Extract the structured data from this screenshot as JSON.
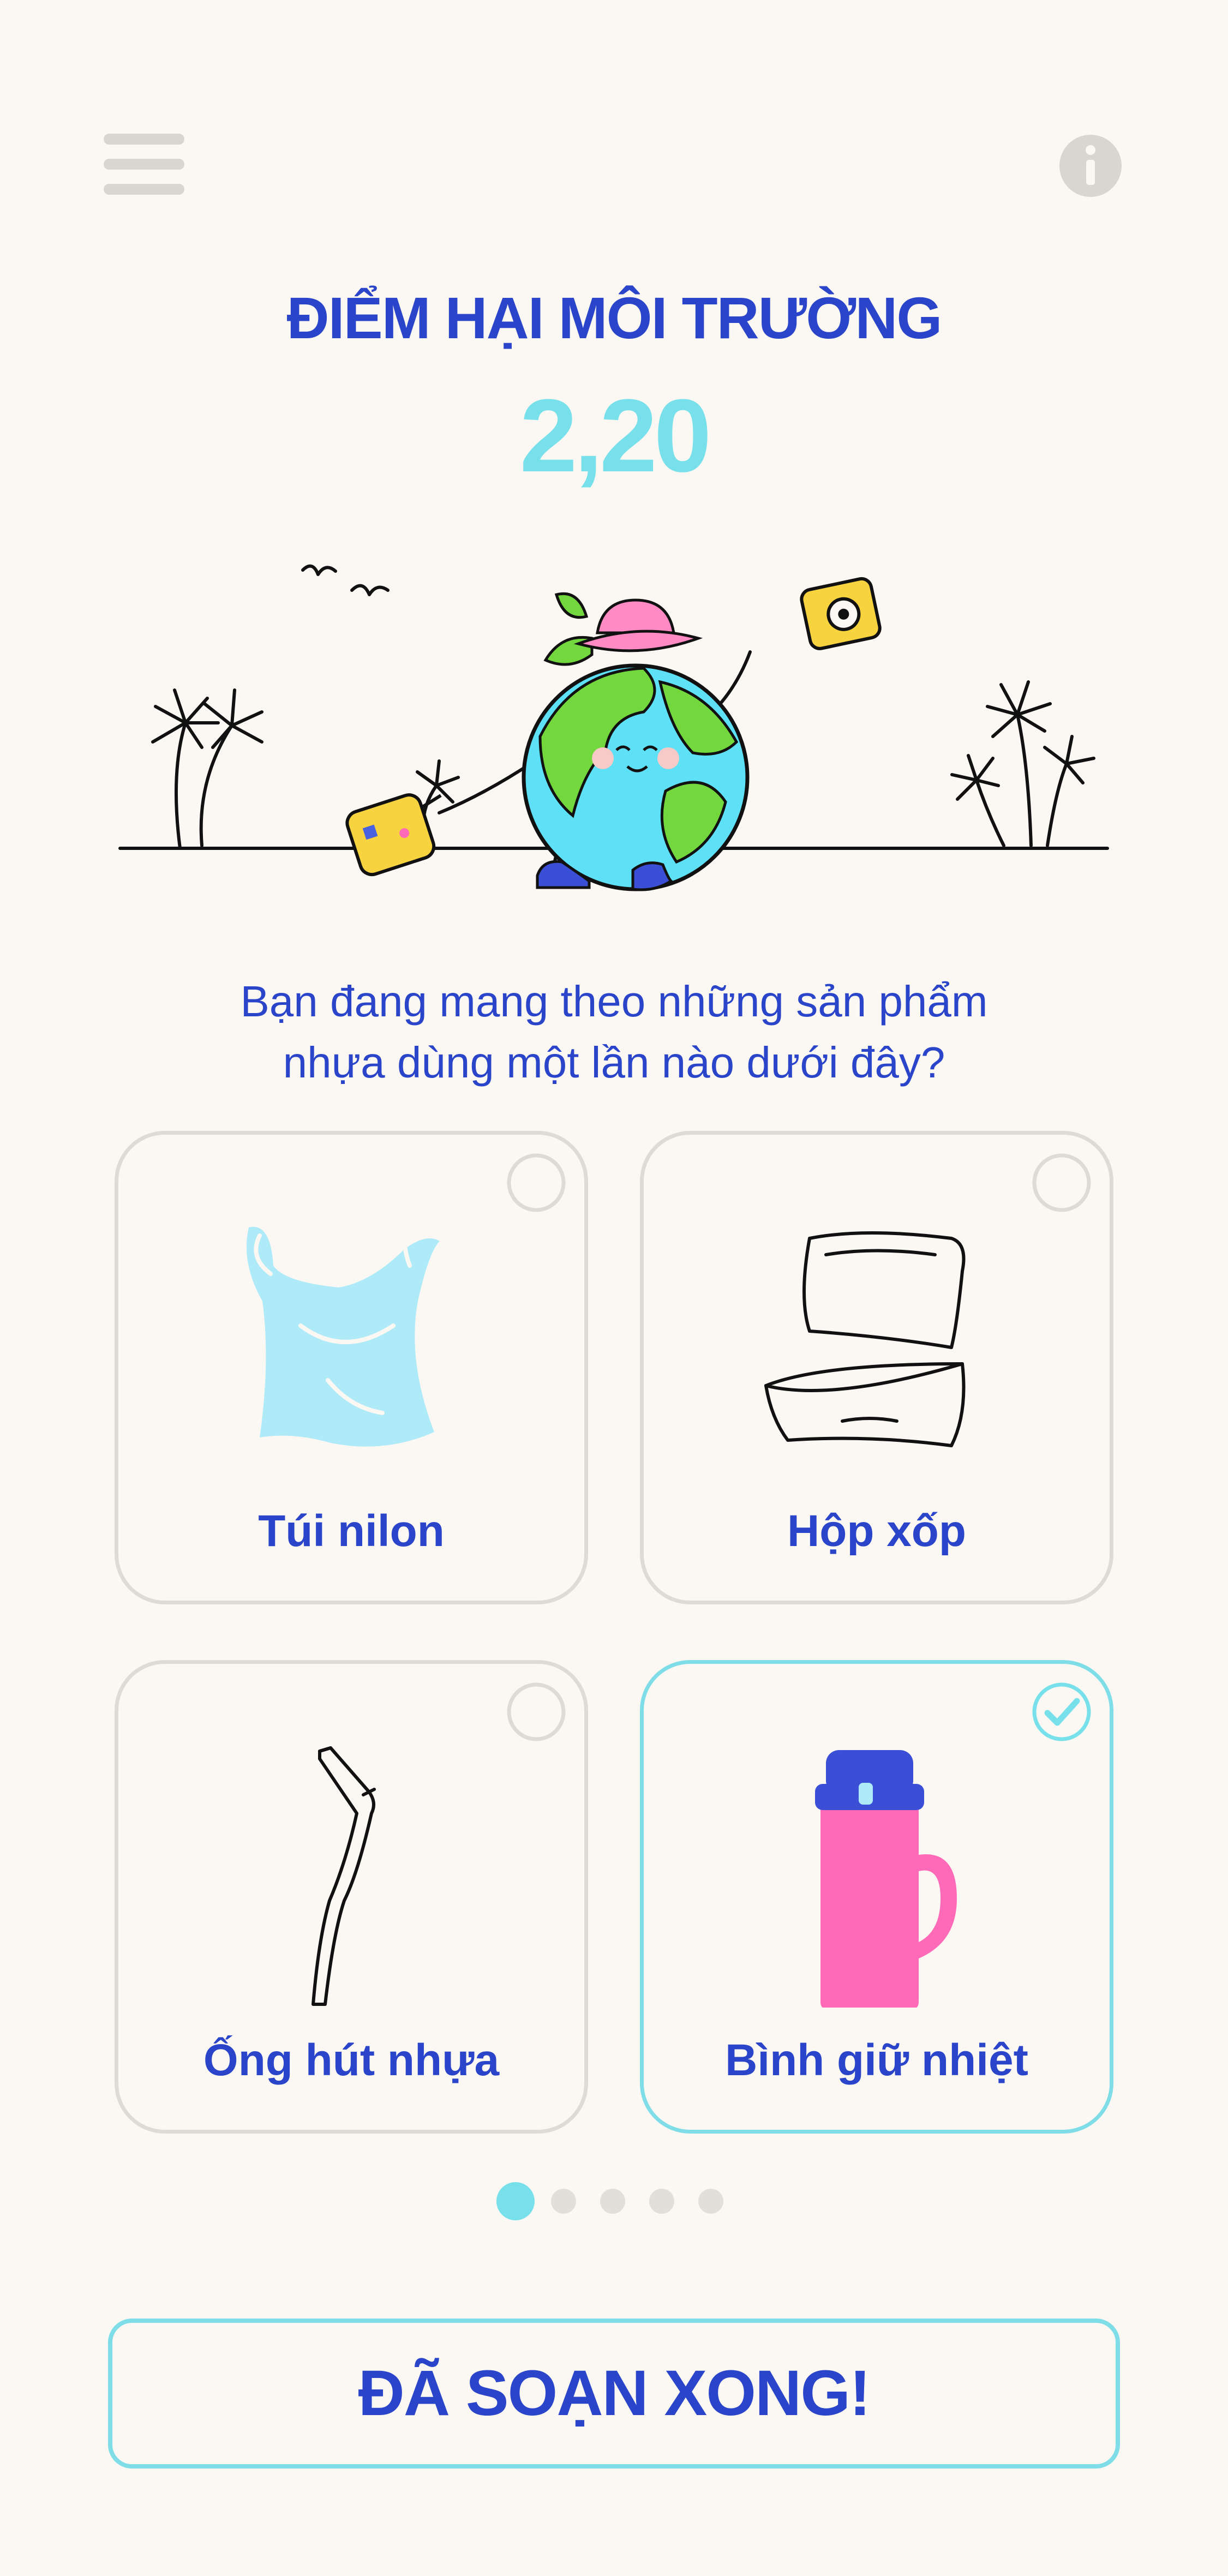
{
  "header": {
    "menu_icon": "hamburger-menu-icon",
    "info_icon": "info-icon",
    "title": "ĐIỂM HẠI MÔI TRƯỜNG",
    "score": "2,20"
  },
  "question": {
    "line1": "Bạn đang mang theo những sản phẩm",
    "line2": "nhựa dùng một lần nào dưới đây?"
  },
  "items": [
    {
      "label": "Túi nilon",
      "icon": "plastic-bag-icon",
      "selected": false
    },
    {
      "label": "Hộp xốp",
      "icon": "foam-box-icon",
      "selected": false
    },
    {
      "label": "Ống hút nhựa",
      "icon": "plastic-straw-icon",
      "selected": false
    },
    {
      "label": "Bình giữ nhiệt",
      "icon": "thermos-bottle-icon",
      "selected": true
    }
  ],
  "pagination": {
    "total": 5,
    "current": 1
  },
  "action": {
    "done_label": "ĐÃ SOẠN XONG!"
  },
  "colors": {
    "background": "#fbf8f3",
    "primary_text": "#2a45c9",
    "accent": "#78e0ea",
    "card_border": "#dedbd6",
    "dot_inactive": "#e2dfda",
    "thermos_pink": "#ff6ab8",
    "bag_blue": "#aeeaf8"
  }
}
